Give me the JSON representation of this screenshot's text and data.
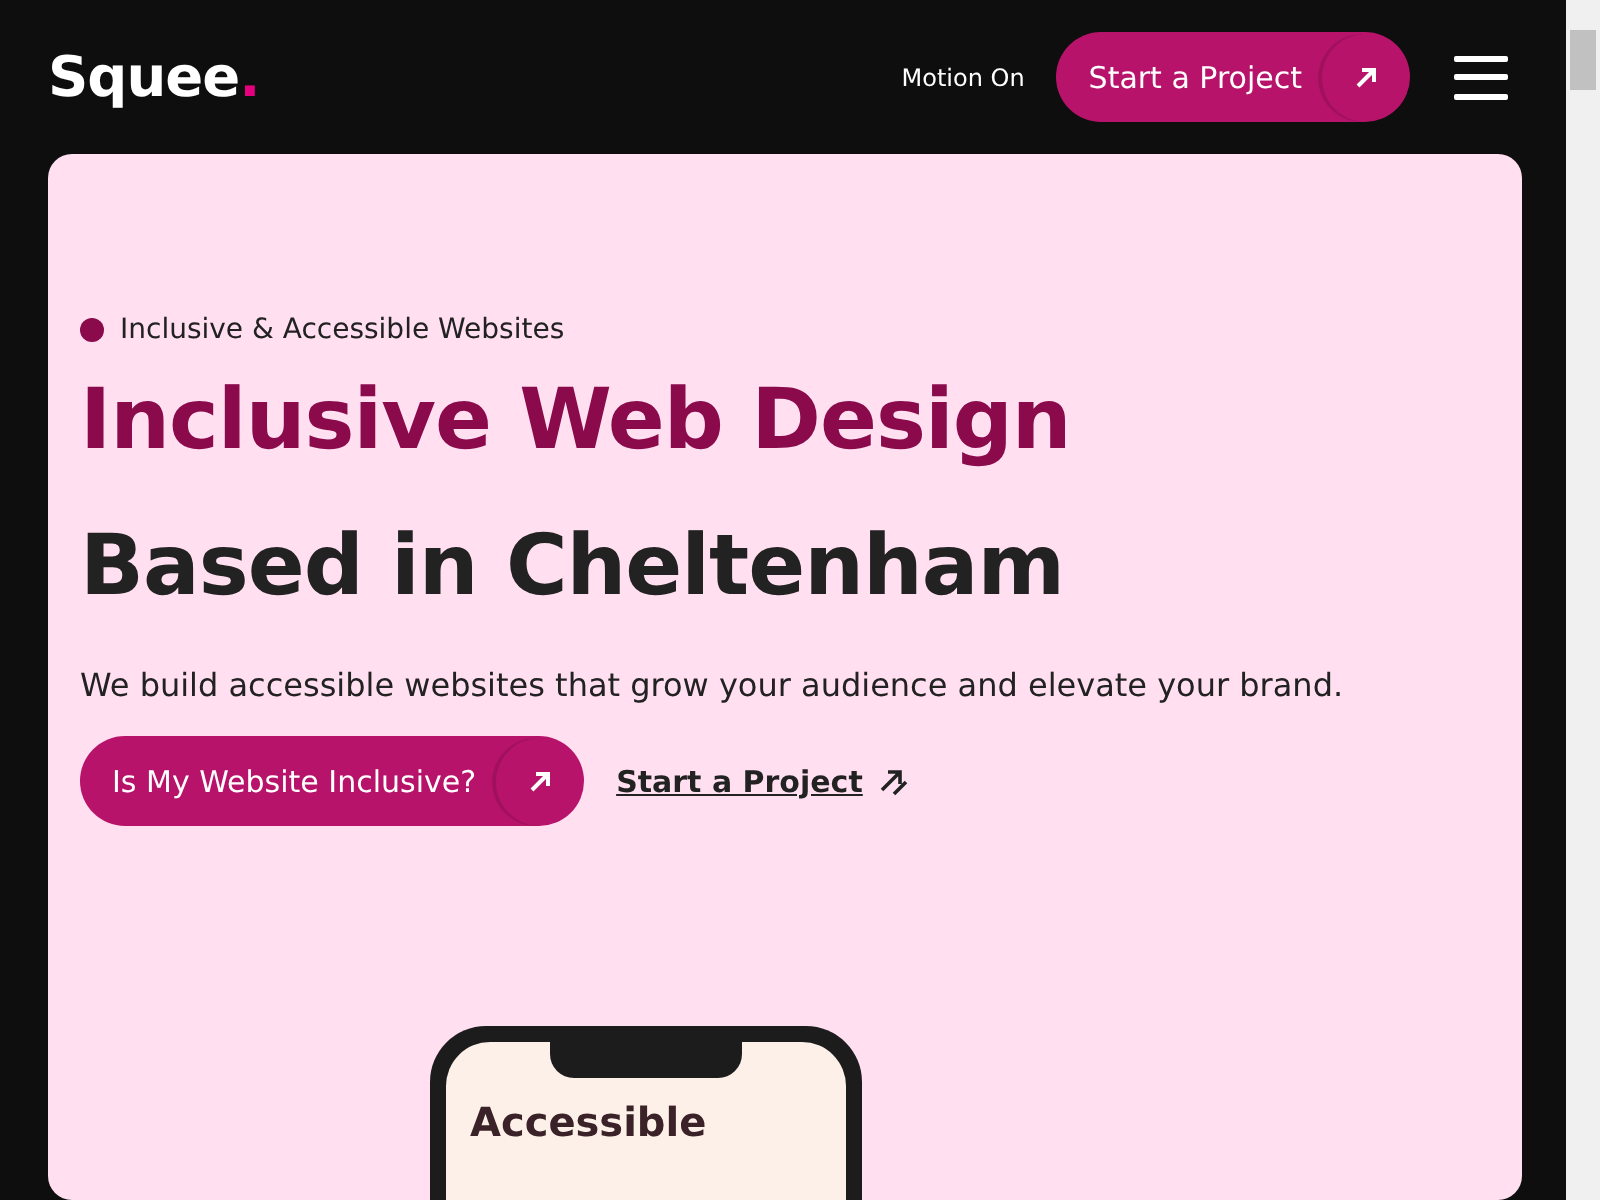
{
  "header": {
    "logo": {
      "name": "Squee",
      "mark": "."
    },
    "motion_toggle": "Motion On",
    "cta": "Start a Project"
  },
  "hero": {
    "tag": "Inclusive & Accessible Websites",
    "title_lines": [
      {
        "text": "Inclusive Web Design",
        "kind": "accent"
      },
      {
        "text": "Based in Cheltenham",
        "kind": "plain"
      }
    ],
    "lead": "We build accessible websites that grow your audience and elevate your brand.",
    "primary_button": "Is My Website Inclusive?",
    "secondary_link": "Start a Project",
    "phone_screen_title": "Accessible"
  }
}
